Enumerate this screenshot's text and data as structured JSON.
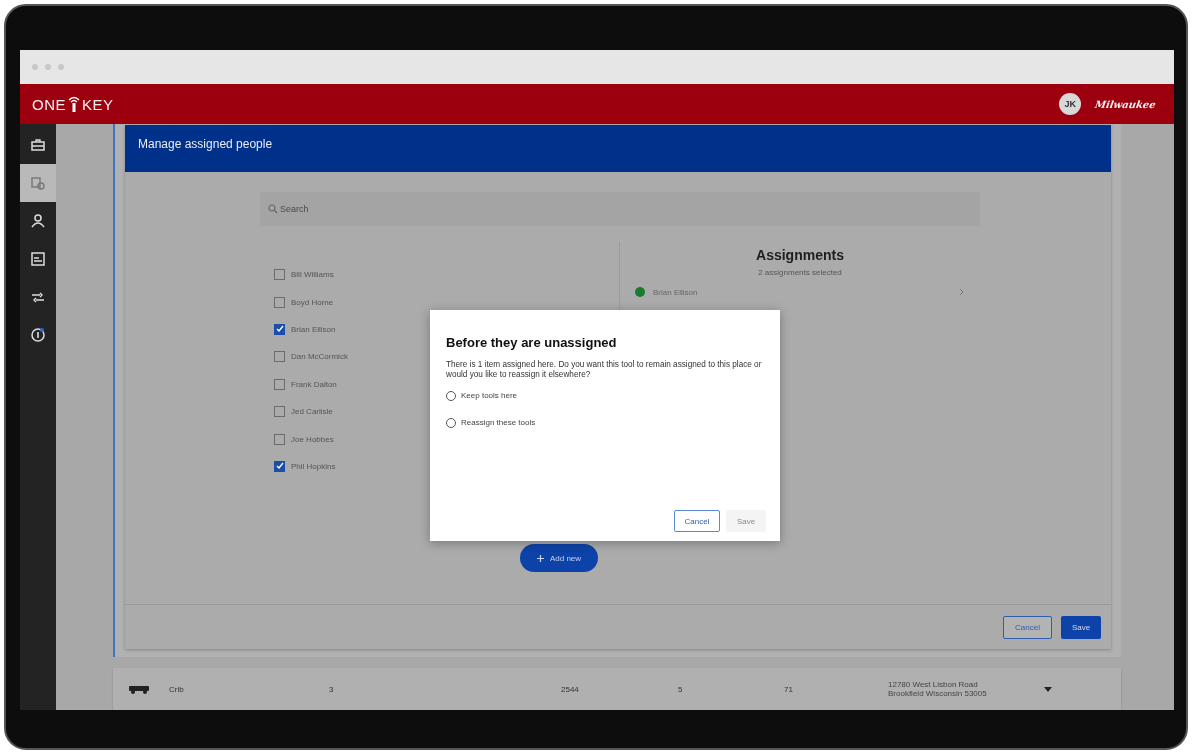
{
  "header": {
    "logo_start": "ONE",
    "logo_end": "KEY",
    "avatar": "JK",
    "brand": "Milwaukee"
  },
  "sidebar": {
    "items": [
      {
        "selected": false
      },
      {
        "selected": true
      },
      {
        "selected": false
      },
      {
        "selected": false
      },
      {
        "selected": false
      },
      {
        "selected": false
      }
    ]
  },
  "manage_panel": {
    "title": "Manage assigned people",
    "search": {
      "placeholder": "Search"
    },
    "people": [
      {
        "name": "Bill Williams",
        "checked": false
      },
      {
        "name": "Boyd Horne",
        "checked": false
      },
      {
        "name": "Brian Ellison",
        "checked": true
      },
      {
        "name": "Dan McCormick",
        "checked": false
      },
      {
        "name": "Frank Dalton",
        "checked": false
      },
      {
        "name": "Jed Carlisle",
        "checked": false
      },
      {
        "name": "Joe Hobbes",
        "checked": false
      },
      {
        "name": "Phil Hopkins",
        "checked": true
      }
    ],
    "assignments": {
      "title": "Assignments",
      "subtitle": "2 assignments selected",
      "items": [
        {
          "name": "Brian Ellison",
          "color": "#1a7a2e"
        }
      ]
    },
    "add_button": "Add new",
    "cancel_button": "Cancel",
    "save_button": "Save"
  },
  "dialog": {
    "title": "Before they are unassigned",
    "message": "There is 1 item assigned here. Do you want this tool to remain assigned to this place or would you like to reassign it elsewhere?",
    "options": [
      {
        "label": "Keep tools here",
        "selected": false
      },
      {
        "label": "Reassign these tools",
        "selected": false
      }
    ],
    "cancel_button": "Cancel",
    "save_button": {
      "label": "Save",
      "disabled": true
    }
  },
  "table_row": {
    "name": "Crib",
    "cells": [
      "3",
      "2544",
      "5",
      "71"
    ],
    "address": [
      "12780 West Lisbon Road",
      "Brookfield Wisconsin 53005"
    ]
  }
}
